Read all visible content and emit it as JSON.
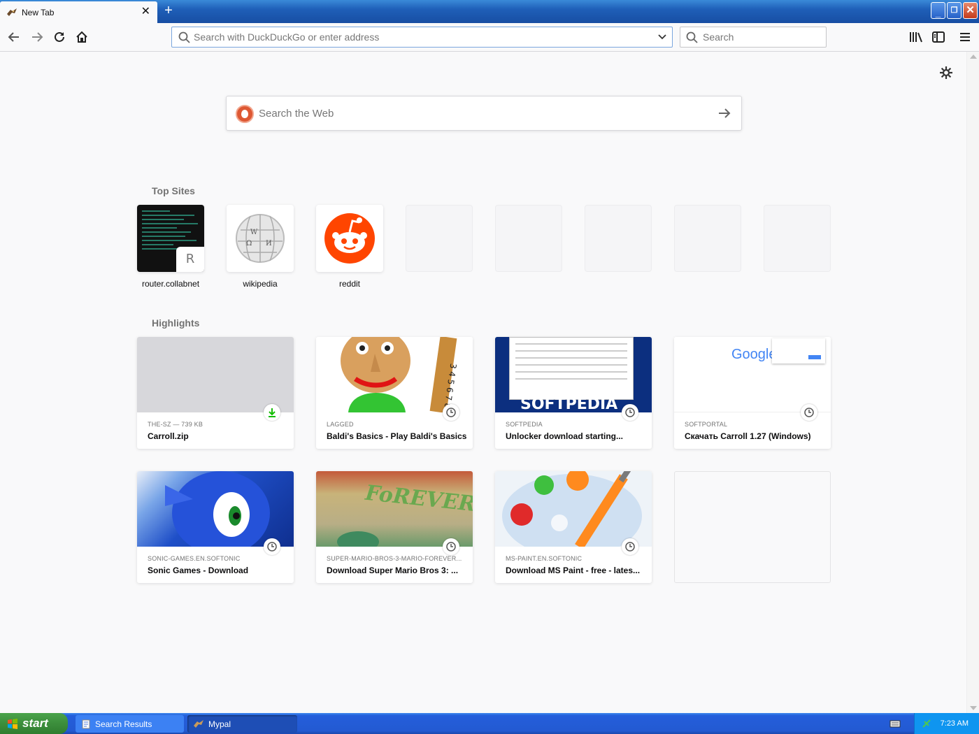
{
  "window": {
    "tab_title": "New Tab",
    "new_tab_symbol": "+",
    "close_tab_symbol": "✕"
  },
  "toolbar": {
    "url_placeholder": "Search with DuckDuckGo or enter address",
    "search_placeholder": "Search"
  },
  "content": {
    "websearch_placeholder": "Search the Web",
    "top_sites_heading": "Top Sites",
    "highlights_heading": "Highlights",
    "top_sites": [
      {
        "label": "router.collabnet",
        "badge": "R"
      },
      {
        "label": "wikipedia"
      },
      {
        "label": "reddit"
      }
    ],
    "highlights": [
      {
        "context": "THE-SZ — 739 KB",
        "title": "Carroll.zip",
        "badge": "download-icon"
      },
      {
        "context": "LAGGED",
        "title": "Baldi's Basics - Play Baldi's Basics...",
        "badge": "clock-icon"
      },
      {
        "context": "SOFTPEDIA",
        "title": "Unlocker download starting...",
        "badge": "clock-icon",
        "thumb_text": "SOFTPEDIA"
      },
      {
        "context": "SOFTPORTAL",
        "title": "Скачать Carroll 1.27 (Windows)",
        "badge": "clock-icon",
        "thumb_text": "Google"
      },
      {
        "context": "SONIC-GAMES.EN.SOFTONIC",
        "title": "Sonic Games - Download",
        "badge": "clock-icon"
      },
      {
        "context": "SUPER-MARIO-BROS-3-MARIO-FOREVER...",
        "title": "Download Super Mario Bros 3: ...",
        "badge": "clock-icon",
        "thumb_text": "FoREVER"
      },
      {
        "context": "MS-PAINT.EN.SOFTONIC",
        "title": "Download MS Paint - free - lates...",
        "badge": "clock-icon"
      }
    ]
  },
  "taskbar": {
    "start_label": "start",
    "items": [
      "Search Results",
      "Mypal"
    ],
    "clock": "7:23 AM"
  },
  "colors": {
    "reddit": "#ff4500",
    "download_green": "#12bc00",
    "taskbar_blue": "#245edb"
  }
}
